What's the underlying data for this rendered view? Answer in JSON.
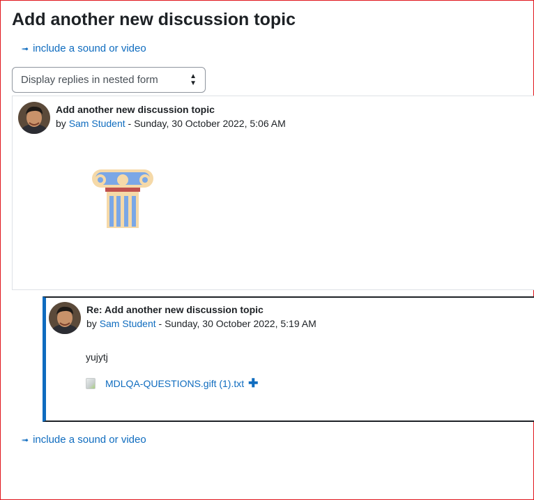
{
  "page": {
    "title": "Add another new discussion topic",
    "media_link_label": "include a sound or video",
    "display_mode": {
      "selected": "Display replies in nested form"
    }
  },
  "posts": [
    {
      "subject": "Add another new discussion topic",
      "by_prefix": "by ",
      "author": "Sam Student",
      "date_sep": " - ",
      "date": "Sunday, 30 October 2022, 5:06 AM",
      "content_image": "ionic-column-icon"
    },
    {
      "subject": "Re: Add another new discussion topic",
      "by_prefix": "by ",
      "author": "Sam Student",
      "date_sep": " - ",
      "date": "Sunday, 30 October 2022, 5:19 AM",
      "body": "yujytj",
      "attachment": {
        "filename": "MDLQA-QUESTIONS.gift (1).txt",
        "action_icon": "plus-icon"
      }
    }
  ],
  "colors": {
    "link": "#0f6cbf",
    "text": "#1d2125",
    "frame": "#e0161c",
    "reply_accent": "#0f6cbf"
  }
}
